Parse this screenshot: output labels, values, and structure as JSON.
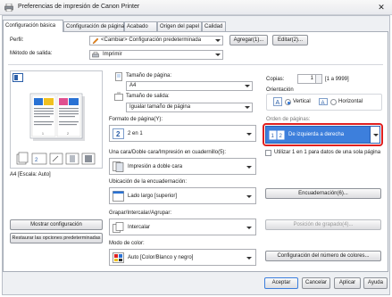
{
  "window": {
    "title": "Preferencias de impresión de Canon Printer",
    "close": "✕"
  },
  "tabs": [
    "Configuración básica",
    "Configuración de página",
    "Acabado",
    "Origen del papel",
    "Calidad"
  ],
  "profile": {
    "label": "Perfil:",
    "value": "<Cambiar> Configuración predeterminada",
    "add": "Agregar(1)...",
    "edit": "Editar(2)..."
  },
  "output": {
    "label": "Método de salida:",
    "value": "Imprimir"
  },
  "preview": {
    "scale_label": "A4 [Escala: Auto]"
  },
  "page_size": {
    "label": "Tamaño de página:",
    "value": "A4"
  },
  "output_size": {
    "label": "Tamaño de salida:",
    "value": "Igualar tamaño de página"
  },
  "copies": {
    "label": "Copias:",
    "value": "1",
    "range": "[1 a 9999]"
  },
  "orientation": {
    "label": "Orientación",
    "portrait": "Vertical",
    "landscape": "Horizontal"
  },
  "page_format": {
    "label": "Formato de página(Y):",
    "value": "2 en 1"
  },
  "page_order": {
    "label": "Orden de páginas:",
    "value": "De izquierda a derecha"
  },
  "one_page_option": {
    "label": "Utilizar 1 en 1 para datos de una sola página"
  },
  "duplex": {
    "label": "Una cara/Doble cara/Impresión en cuadernillo(5):",
    "value": "Impresión a doble cara"
  },
  "binding": {
    "label": "Ubicación de la encuadernación:",
    "value": "Lado largo [superior]",
    "button": "Encuadernación(6)..."
  },
  "staple": {
    "label": "Grapar/Intercalar/Agrupar:",
    "value": "Intercalar",
    "button": "Posición de grapado(4)..."
  },
  "color": {
    "label": "Modo de color:",
    "value": "Auto [Color/Blanco y negro]",
    "button": "Configuración del número de colores..."
  },
  "left_buttons": {
    "show_settings": "Mostrar configuración",
    "restore": "Restaurar las opciones predeterminadas"
  },
  "footer": {
    "ok": "Aceptar",
    "cancel": "Cancelar",
    "apply": "Aplicar",
    "help": "Ayuda"
  }
}
